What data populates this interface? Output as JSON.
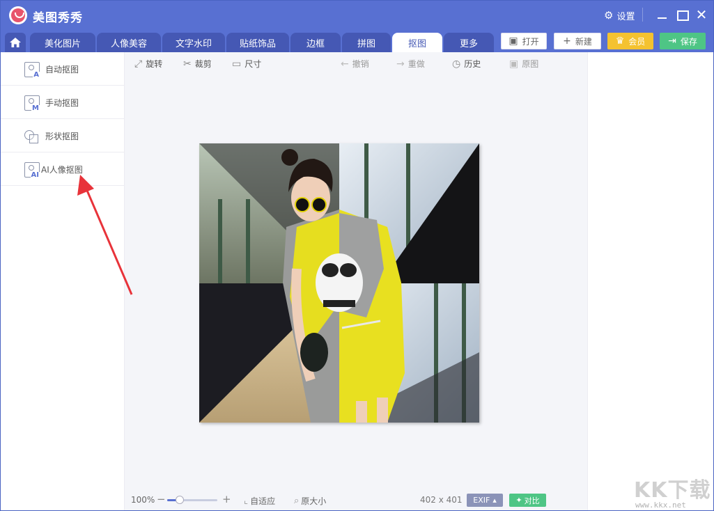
{
  "app": {
    "title": "美图秀秀",
    "settings_label": "设置",
    "close_glyph": "✕"
  },
  "tabs": [
    {
      "label": "美化图片",
      "active": false
    },
    {
      "label": "人像美容",
      "active": false
    },
    {
      "label": "文字水印",
      "active": false
    },
    {
      "label": "贴纸饰品",
      "active": false
    },
    {
      "label": "边框",
      "active": false
    },
    {
      "label": "拼图",
      "active": false
    },
    {
      "label": "抠图",
      "active": true
    },
    {
      "label": "更多",
      "active": false
    }
  ],
  "actions": {
    "open": "打开",
    "new": "新建",
    "vip": "会员",
    "save": "保存"
  },
  "left_menu": [
    {
      "label": "自动抠图",
      "icon": "auto-cutout-icon",
      "badge": "A"
    },
    {
      "label": "手动抠图",
      "icon": "manual-cutout-icon",
      "badge": "M"
    },
    {
      "label": "形状抠图",
      "icon": "shape-cutout-icon",
      "badge": ""
    },
    {
      "label": "AI人像抠图",
      "icon": "ai-portrait-cutout-icon",
      "badge": "AI"
    }
  ],
  "toolbar": {
    "rotate": "旋转",
    "crop": "裁剪",
    "size": "尺寸",
    "undo": "撤销",
    "redo": "重做",
    "history": "历史",
    "original": "原图"
  },
  "bottom": {
    "zoom": "100%",
    "zoom_level": 0.25,
    "fit": "自适应",
    "actual_size": "原大小",
    "dimensions": "402 x 401",
    "exif": "EXIF",
    "compare": "对比"
  },
  "watermark": {
    "logo": "KK下载",
    "url": "www.kkx.net"
  },
  "colors": {
    "brand": "#5870d2",
    "tab_inactive": "#4558b4",
    "vip": "#f4c230",
    "save": "#4ec585",
    "arrow": "#e8333a"
  }
}
